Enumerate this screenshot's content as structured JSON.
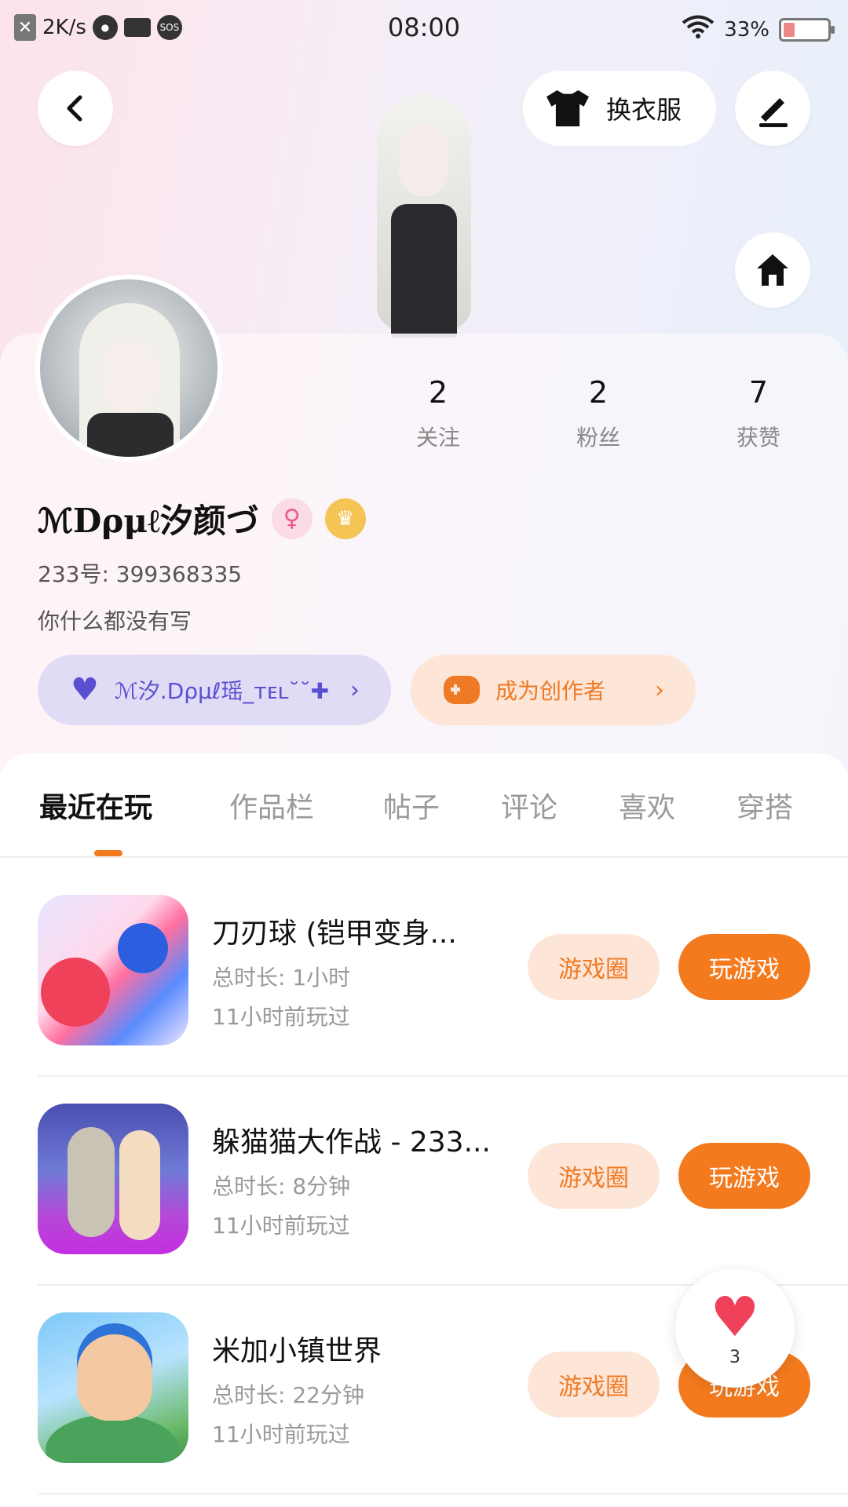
{
  "status_bar": {
    "speed": "2K/s",
    "sos": "SOS",
    "time": "08:00",
    "battery": "33%"
  },
  "header": {
    "outfit_label": "换衣服"
  },
  "profile": {
    "stats": [
      {
        "value": "2",
        "label": "关注"
      },
      {
        "value": "2",
        "label": "粉丝"
      },
      {
        "value": "7",
        "label": "获赞"
      }
    ],
    "name": "ℳDρμℓ汐颜づ",
    "uid": "233号: 399368335",
    "bio": "你什么都没有写",
    "group_label": "ℳ汐.Dρμℓ瑶_ᴛᴇʟ˘˘✚",
    "creator_label": "成为创作者"
  },
  "tabs": [
    "最近在玩",
    "作品栏",
    "帖子",
    "评论",
    "喜欢",
    "穿搭"
  ],
  "games": [
    {
      "title": "刀刃球 (铠甲变身...",
      "duration": "总时长: 1小时",
      "last_played": "11小时前玩过"
    },
    {
      "title": "躲猫猫大作战 - 233...",
      "duration": "总时长: 8分钟",
      "last_played": "11小时前玩过"
    },
    {
      "title": "米加小镇世界",
      "duration": "总时长: 22分钟",
      "last_played": "11小时前玩过"
    }
  ],
  "game_buttons": {
    "circle": "游戏圈",
    "play": "玩游戏"
  },
  "float_like": {
    "count": "3"
  },
  "colors": {
    "accent": "#f47a1e",
    "accent_soft": "#fde6d8",
    "group_purple": "#5a4fd0"
  }
}
